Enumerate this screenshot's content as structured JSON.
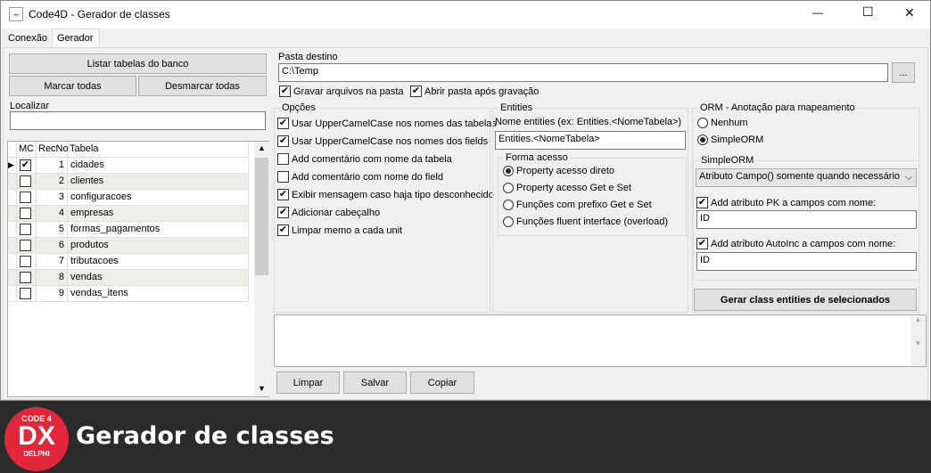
{
  "window": {
    "title": "Code4D - Gerador de classes",
    "minimize": "—",
    "maximize": "☐",
    "close": "✕"
  },
  "tabs": [
    "Conexão",
    "Gerador"
  ],
  "left": {
    "list_button": "Listar tabelas do banco",
    "mark_all": "Marcar todas",
    "unmark_all": "Desmarcar todas",
    "search_label": "Localizar",
    "search_value": "",
    "grid": {
      "headers": [
        "MC",
        "RecNo",
        "Tabela"
      ],
      "rows": [
        {
          "mc": true,
          "recno": "1",
          "tabela": "cidades"
        },
        {
          "mc": false,
          "recno": "2",
          "tabela": "clientes"
        },
        {
          "mc": false,
          "recno": "3",
          "tabela": "configuracoes"
        },
        {
          "mc": false,
          "recno": "4",
          "tabela": "empresas"
        },
        {
          "mc": false,
          "recno": "5",
          "tabela": "formas_pagamentos"
        },
        {
          "mc": false,
          "recno": "6",
          "tabela": "produtos"
        },
        {
          "mc": false,
          "recno": "7",
          "tabela": "tributacoes"
        },
        {
          "mc": false,
          "recno": "8",
          "tabela": "vendas"
        },
        {
          "mc": false,
          "recno": "9",
          "tabela": "vendas_itens"
        }
      ]
    }
  },
  "dest": {
    "label": "Pasta destino",
    "value": "C:\\Temp",
    "browse": "...",
    "save_files": "Gravar arquivos na pasta",
    "open_folder": "Abrir pasta após gravação"
  },
  "options": {
    "title": "Opções",
    "items": [
      {
        "label": "Usar UpperCamelCase nos nomes das tabelas",
        "checked": true
      },
      {
        "label": "Usar UpperCamelCase nos nomes dos fields",
        "checked": true
      },
      {
        "label": "Add comentário com nome da tabela",
        "checked": false
      },
      {
        "label": "Add comentário com nome do field",
        "checked": false
      },
      {
        "label": "Exibir mensagem caso haja tipo desconhecido",
        "checked": true
      },
      {
        "label": "Adicionar cabeçalho",
        "checked": true
      },
      {
        "label": "Limpar memo a cada unit",
        "checked": true
      }
    ]
  },
  "entities": {
    "title": "Entities",
    "name_label": "Nome entities (ex: Entities.<NomeTabela>)",
    "name_value": "Entities.<NomeTabela>",
    "access_title": "Forma acesso",
    "access": [
      {
        "label": "Property acesso direto",
        "selected": true
      },
      {
        "label": "Property acesso Get e Set",
        "selected": false
      },
      {
        "label": "Funções com prefixo Get e Set",
        "selected": false
      },
      {
        "label": "Funções fluent interface (overload)",
        "selected": false
      }
    ]
  },
  "orm": {
    "title": "ORM - Anotação para mapeamento",
    "options": [
      {
        "label": "Nenhum",
        "selected": false
      },
      {
        "label": "SimpleORM",
        "selected": true
      }
    ],
    "simple_title": "SimpleORM",
    "select_value": "Atributo Campo() somente quando necessário",
    "pk_label": "Add atributo PK a campos com nome:",
    "pk_value": "ID",
    "ai_label": "Add atributo AutoInc a campos com nome:",
    "ai_value": "ID",
    "generate": "Gerar class entities de selecionados"
  },
  "bottom": {
    "clear": "Limpar",
    "save": "Salvar",
    "copy": "Copiar"
  },
  "banner": {
    "title": "Gerador de classes",
    "logo_top": "CODE 4",
    "logo_mid": "DX",
    "logo_bottom": "DELPHI"
  }
}
